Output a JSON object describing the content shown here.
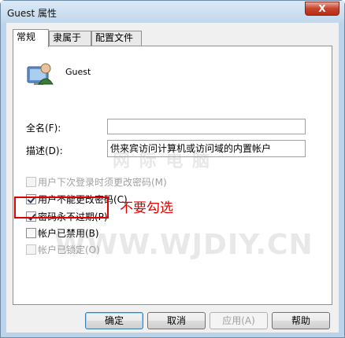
{
  "window": {
    "title": "Guest 属性",
    "close_glyph": "X"
  },
  "tabs": [
    {
      "label": "常规",
      "active": true
    },
    {
      "label": "隶属于",
      "active": false
    },
    {
      "label": "配置文件",
      "active": false
    }
  ],
  "user": {
    "name": "Guest",
    "icon": "user-icon"
  },
  "fields": {
    "fullname_label": "全名(F):",
    "fullname_value": "",
    "description_label": "描述(D):",
    "description_value": "供来宾访问计算机或访问域的内置帐户"
  },
  "checkboxes": [
    {
      "label": "用户下次登录时须更改密码(M)",
      "checked": false,
      "disabled": true
    },
    {
      "label": "用户不能更改密码(C)",
      "checked": true,
      "disabled": false
    },
    {
      "label": "密码永不过期(P)",
      "checked": true,
      "disabled": false
    },
    {
      "label": "帐户已禁用(B)",
      "checked": false,
      "disabled": false
    },
    {
      "label": "帐户已锁定(O)",
      "checked": false,
      "disabled": true
    }
  ],
  "annotation": {
    "text": "不要勾选",
    "color": "#e00000"
  },
  "watermarks": {
    "large": "WWW.WJDIY.CN",
    "small": "网 际 电 脑"
  },
  "buttons": {
    "ok": "确定",
    "cancel": "取消",
    "apply": "应用(A)",
    "help": "帮助"
  }
}
